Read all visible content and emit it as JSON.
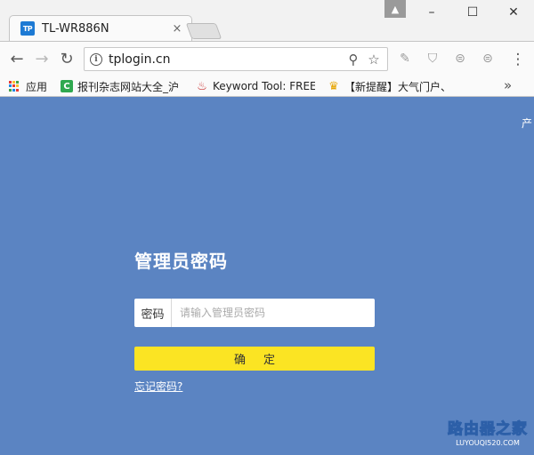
{
  "browser": {
    "tab": {
      "favicon_text": "TP",
      "title": "TL-WR886N",
      "close_glyph": "×"
    },
    "window_controls": {
      "profile_glyph": "▲",
      "minimize": "–",
      "maximize": "☐",
      "close": "✕"
    },
    "toolbar": {
      "back_glyph": "←",
      "forward_glyph": "→",
      "reload_glyph": "↻",
      "url": "tplogin.cn",
      "info_glyph": "i",
      "zoom_glyph": "⚲",
      "star_glyph": "☆",
      "menu_glyph": "⋮",
      "extensions": [
        {
          "name": "extension-1-icon",
          "glyph": "✎"
        },
        {
          "name": "extension-2-icon",
          "glyph": "⛉"
        },
        {
          "name": "extension-3-icon",
          "glyph": "⊜"
        },
        {
          "name": "extension-4-icon",
          "glyph": "⊜"
        }
      ]
    },
    "bookmarks": [
      {
        "label": "应用",
        "icon": "apps-grid-icon"
      },
      {
        "label": "报刊杂志网站大全_沪",
        "icon": "green-c-icon"
      },
      {
        "label": "Keyword Tool: FREE",
        "icon": "flame-icon"
      },
      {
        "label": "【新提醒】大气门户、",
        "icon": "trophy-icon"
      }
    ],
    "bookmarks_more_glyph": "»"
  },
  "page": {
    "corner_text": "产",
    "title": "管理员密码",
    "password_label": "密码",
    "password_placeholder": "请输入管理员密码",
    "confirm_label": "确定",
    "forgot_link": "忘记密码?",
    "watermark_main": "路由器之家",
    "watermark_sub": "LUYOUQI520.COM"
  },
  "colors": {
    "page_background": "#5b84c2",
    "confirm_button": "#fbe423",
    "favicon": "#1d7ad4"
  }
}
